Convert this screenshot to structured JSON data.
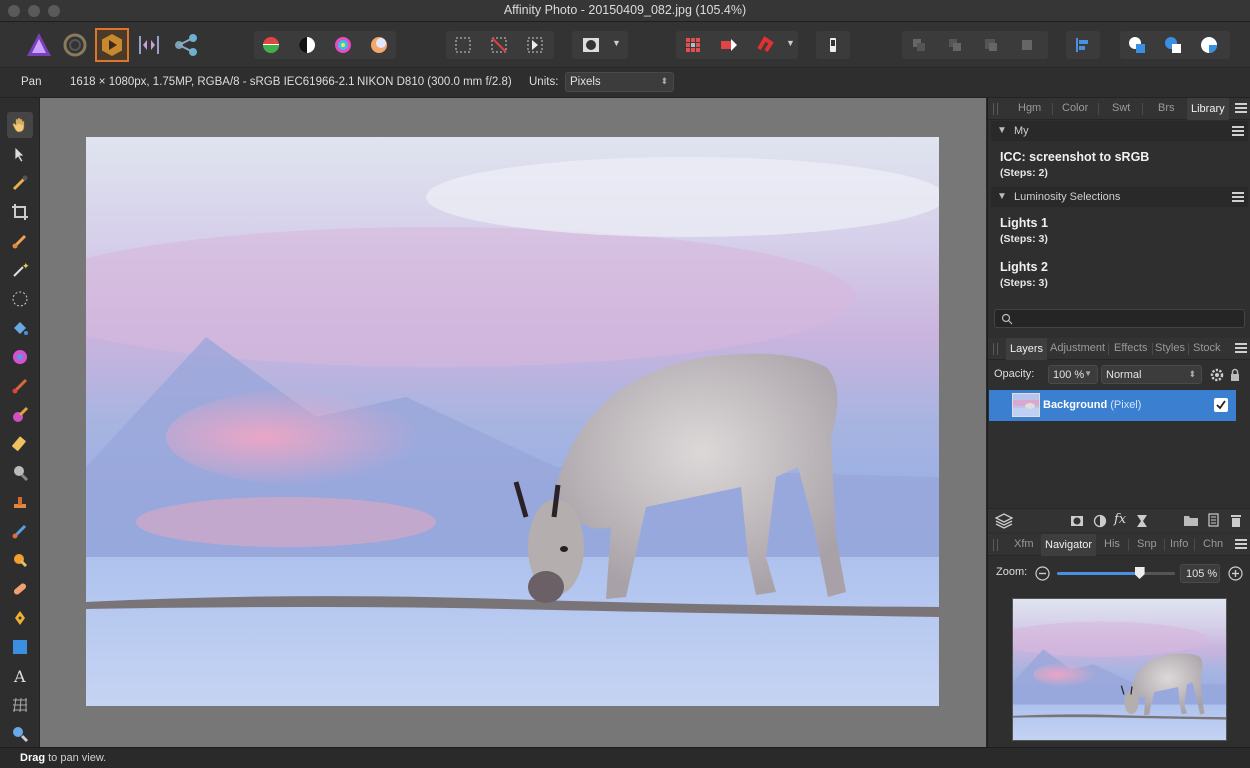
{
  "window": {
    "title": "Affinity Photo - 20150409_082.jpg (105.4%)"
  },
  "context_bar": {
    "tool_name": "Pan",
    "image_info": "1618 × 1080px, 1.75MP, RGBA/8 - sRGB IEC61966-2.1",
    "camera_info": "NIKON D810 (300.0 mm f/2.8)",
    "units_label": "Units:",
    "units_value": "Pixels"
  },
  "studio_tabs_top": [
    {
      "label": "Hgm"
    },
    {
      "label": "Color"
    },
    {
      "label": "Swt"
    },
    {
      "label": "Brs"
    },
    {
      "label": "Library",
      "active": true
    }
  ],
  "library": {
    "category_my": "My",
    "items_my": [
      {
        "name": "ICC: screenshot to sRGB",
        "steps": "(Steps: 2)"
      }
    ],
    "category_lum": "Luminosity Selections",
    "items_lum": [
      {
        "name": "Lights 1",
        "steps": "(Steps: 3)"
      },
      {
        "name": "Lights 2",
        "steps": "(Steps: 3)"
      }
    ]
  },
  "layers_tabs": [
    {
      "label": "Layers",
      "active": true
    },
    {
      "label": "Adjustment"
    },
    {
      "label": "Effects"
    },
    {
      "label": "Styles"
    },
    {
      "label": "Stock"
    }
  ],
  "layers": {
    "opacity_label": "Opacity:",
    "opacity_value": "100 %",
    "blend_mode": "Normal",
    "layer_name": "Background",
    "layer_type": "(Pixel)",
    "layer_visible": true
  },
  "nav_tabs": [
    {
      "label": "Xfm"
    },
    {
      "label": "Navigator",
      "active": true
    },
    {
      "label": "His"
    },
    {
      "label": "Snp"
    },
    {
      "label": "Info"
    },
    {
      "label": "Chn"
    }
  ],
  "navigator": {
    "zoom_label": "Zoom:",
    "zoom_value": "105 %",
    "zoom_fraction": 0.7
  },
  "status": {
    "bold": "Drag",
    "rest": " to pan view."
  },
  "colors": {
    "accent": "#3a7fd0",
    "persona_active": "#e0752a"
  }
}
